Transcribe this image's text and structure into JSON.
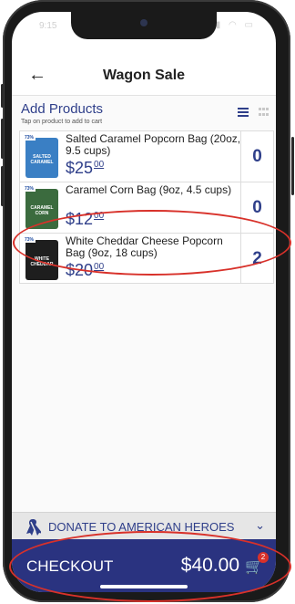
{
  "status_bar": {
    "time": "9:15",
    "icons": "▮▮ ◠ ▭"
  },
  "header": {
    "back_icon": "←",
    "title": "Wagon Sale"
  },
  "section": {
    "title": "Add Products",
    "subtitle": "Tap on product to add to cart"
  },
  "products": [
    {
      "name": "Salted Caramel Popcorn Bag (20oz, 9.5 cups)",
      "price_main": "$25",
      "price_cents": "00",
      "quantity": "0",
      "badge": "73%",
      "bag_color": "#3a7fc4",
      "bag_label": "SALTED CARAMEL"
    },
    {
      "name": "Caramel Corn Bag (9oz, 4.5 cups)",
      "price_main": "$12",
      "price_cents": "00",
      "quantity": "0",
      "badge": "73%",
      "bag_color": "#3b6b3e",
      "bag_label": "CARAMEL CORN"
    },
    {
      "name": "White Cheddar Cheese Popcorn Bag (9oz, 18 cups)",
      "price_main": "$20",
      "price_cents": "00",
      "quantity": "2",
      "badge": "73%",
      "bag_color": "#1e1e1e",
      "bag_label": "WHITE CHEDDAR"
    }
  ],
  "donate": {
    "label": "DONATE TO AMERICAN HEROES",
    "chevron": "⌄"
  },
  "checkout": {
    "label": "CHECKOUT",
    "total": "$40.00",
    "cart_count": "2"
  },
  "colors": {
    "brand": "#2a3380",
    "accent_text": "#2f3f8a",
    "annotation": "#d8312a"
  }
}
